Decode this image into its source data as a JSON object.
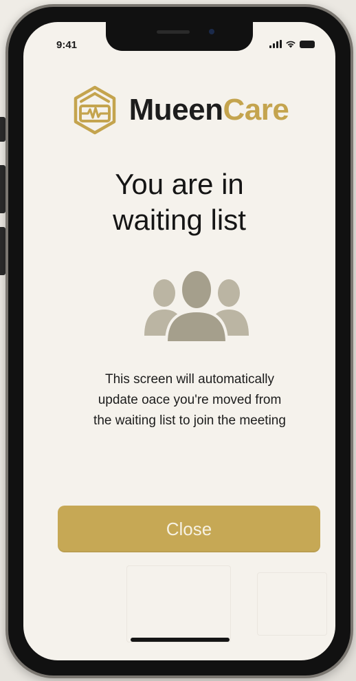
{
  "status_bar": {
    "time": "9:41"
  },
  "brand": {
    "part1": "Mueen",
    "part2": "Care",
    "gold_color": "#c4a44e",
    "dark_color": "#1d1d1d"
  },
  "title": {
    "line1": "You are in",
    "line2": "waiting list"
  },
  "message": {
    "line1": "This screen will automatically",
    "line2": "update oace you're moved from",
    "line3": "the waiting list to join the meeting"
  },
  "close_button": {
    "label": "Close",
    "color": "#c6a855"
  },
  "icons": {
    "logo": "hexagon-heartbeat-icon",
    "people": "group-people-icon"
  }
}
